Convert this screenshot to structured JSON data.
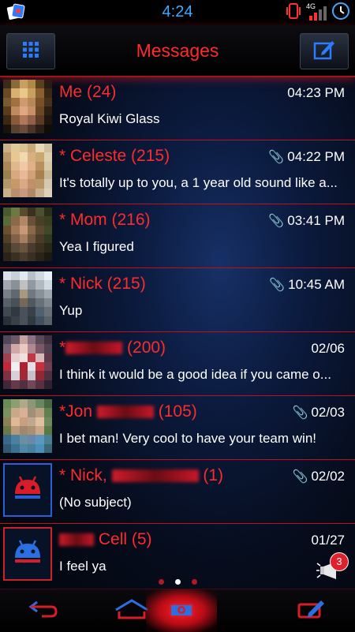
{
  "status": {
    "time": "4:24",
    "network": "4G"
  },
  "header": {
    "title": "Messages",
    "menu_icon": "grid-icon",
    "compose_icon": "compose-icon"
  },
  "threads": [
    {
      "name": "Me (24)",
      "time": "04:23 PM",
      "snippet": "Royal Kiwi Glass",
      "attachment": false
    },
    {
      "name": "* Celeste (215)",
      "time": "04:22 PM",
      "snippet": "It's totally up to you, a 1 year old sound like a...",
      "attachment": true
    },
    {
      "name": "* Mom (216)",
      "time": "03:41 PM",
      "snippet": "Yea I figured",
      "attachment": true
    },
    {
      "name": "* Nick (215)",
      "time": "10:45 AM",
      "snippet": "Yup",
      "attachment": true
    },
    {
      "name_prefix": "*",
      "name_suffix": "(200)",
      "time": "02/06",
      "snippet": "I think it would be a good idea if you came o...",
      "attachment": false
    },
    {
      "name_prefix": "*Jon",
      "name_suffix": "(105)",
      "time": "02/03",
      "snippet": "I bet man! Very cool to have your team win!",
      "attachment": true
    },
    {
      "name_prefix": "* Nick,",
      "name_suffix": "(1)",
      "time": "02/02",
      "snippet": "(No subject)",
      "attachment": true
    },
    {
      "name_prefix": "",
      "name_suffix": "Cell (5)",
      "time": "01/27",
      "snippet": "I feel ya",
      "attachment": false
    }
  ],
  "notification_count": "3",
  "colors": {
    "accent_red": "#ff2b2b",
    "status_blue": "#3fa9ff",
    "divider": "#c0101c"
  }
}
